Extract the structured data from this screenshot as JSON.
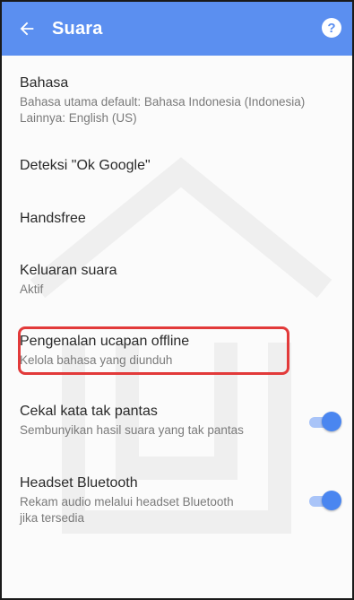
{
  "header": {
    "title": "Suara",
    "help_label": "?"
  },
  "items": [
    {
      "title": "Bahasa",
      "subtitle": "Bahasa utama default: Bahasa Indonesia (Indonesia)\nLainnya: English (US)"
    },
    {
      "title": "Deteksi \"Ok Google\"",
      "subtitle": ""
    },
    {
      "title": "Handsfree",
      "subtitle": ""
    },
    {
      "title": "Keluaran suara",
      "subtitle": "Aktif"
    },
    {
      "title": "Pengenalan ucapan offline",
      "subtitle": "Kelola bahasa yang diunduh"
    },
    {
      "title": "Cekal kata tak pantas",
      "subtitle": "Sembunyikan hasil suara yang tak pantas",
      "toggle": true
    },
    {
      "title": "Headset Bluetooth",
      "subtitle": "Rekam audio melalui headset Bluetooth\njika tersedia",
      "toggle": true
    }
  ],
  "colors": {
    "appbar": "#5b8ff0",
    "highlight": "#e23a3a",
    "toggle_on": "#4a86f0"
  },
  "icons": [
    "back-arrow-icon",
    "help-icon"
  ]
}
